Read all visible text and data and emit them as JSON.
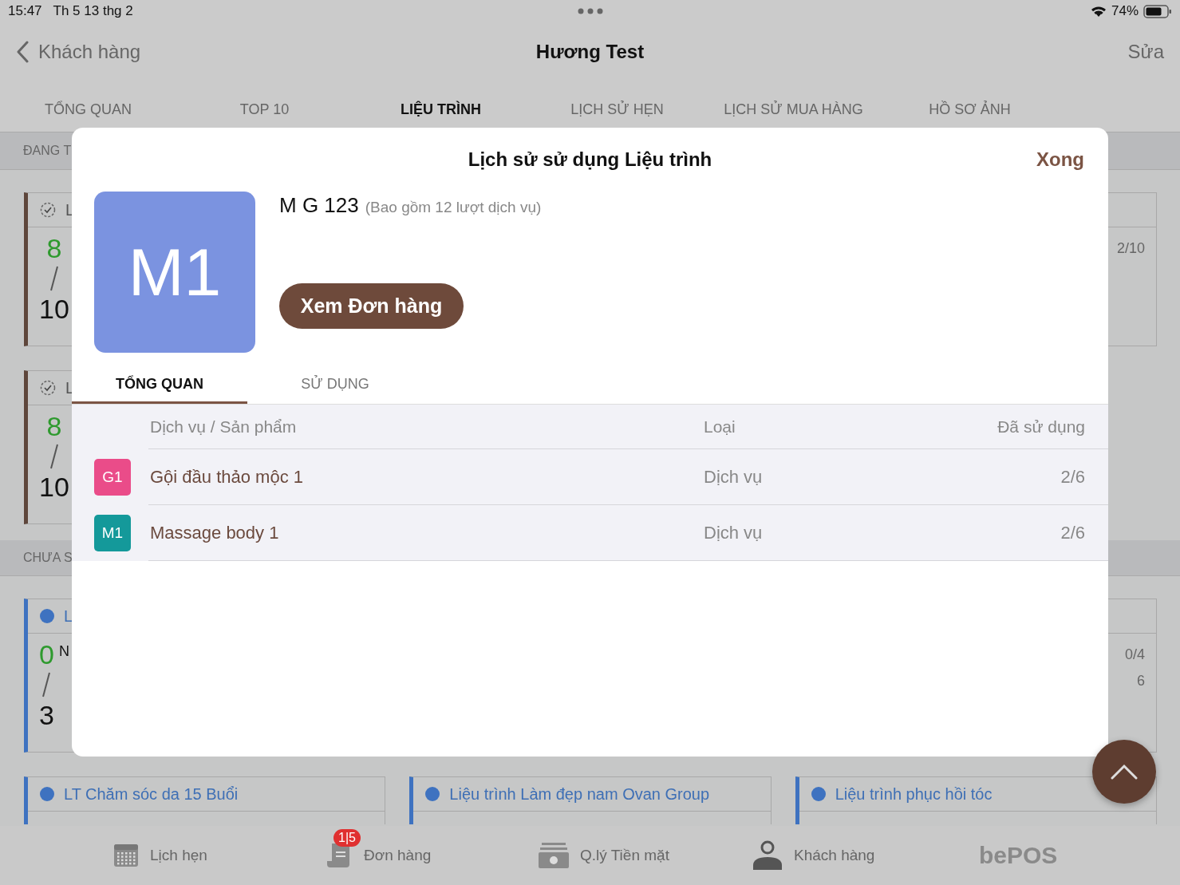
{
  "status_bar": {
    "time": "15:47",
    "date": "Th 5 13 thg 2",
    "battery": "74%"
  },
  "nav": {
    "back": "Khách hàng",
    "title": "Hương Test",
    "action": "Sửa"
  },
  "tabs": [
    {
      "label": "TỔNG QUAN",
      "selected": false
    },
    {
      "label": "TOP 10",
      "selected": false
    },
    {
      "label": "LIỆU TRÌNH",
      "selected": true
    },
    {
      "label": "LỊCH SỬ HẸN",
      "selected": false
    },
    {
      "label": "LỊCH SỬ MUA HÀNG",
      "selected": false
    },
    {
      "label": "HỒ SƠ ẢNH",
      "selected": false
    }
  ],
  "sections": [
    {
      "title": "ĐANG T",
      "rows": [
        [
          {
            "kind": "used",
            "title": "L",
            "used": "8",
            "total": "10"
          },
          null,
          {
            "kind": "used",
            "usage": "2/10"
          }
        ],
        [
          {
            "kind": "used",
            "title": "L",
            "used": "8",
            "total": "10"
          }
        ]
      ]
    },
    {
      "title": "CHƯA S",
      "rows": [
        [
          {
            "kind": "unused",
            "title": "L",
            "used": "0",
            "total": "3",
            "note": "N"
          },
          null,
          {
            "kind": "unused",
            "usage": "0/4",
            "extra": "6"
          }
        ],
        [
          {
            "kind": "unused",
            "title": "LT Chăm sóc da 15 Buổi"
          },
          {
            "kind": "unused",
            "title": "Liệu trình Làm đẹp nam Ovan Group"
          },
          {
            "kind": "unused",
            "title": "Liệu trình phục hồi tóc"
          }
        ]
      ]
    }
  ],
  "bottom_tabs": [
    {
      "kind": "calendar",
      "label": "Lịch hẹn"
    },
    {
      "kind": "orders",
      "label": "Đơn hàng",
      "badge": "1|5"
    },
    {
      "kind": "cash",
      "label": "Q.lý Tiền mặt"
    },
    {
      "kind": "person",
      "label": "Khách hàng"
    }
  ],
  "brand": "bePOS",
  "modal": {
    "title": "Lịch sử sử dụng Liệu trình",
    "done": "Xong",
    "avatar": "M1",
    "name": "M G 123",
    "subtitle": "(Bao gồm 12 lượt dịch vụ)",
    "button": "Xem Đơn hàng",
    "tabs": [
      {
        "label": "TỔNG QUAN",
        "selected": true
      },
      {
        "label": "SỬ DỤNG",
        "selected": false
      }
    ],
    "columns": [
      "Dịch vụ / Sản phẩm",
      "Loại",
      "Đã sử dụng"
    ],
    "rows": [
      {
        "badge": "G1",
        "color": "#ea4c89",
        "name": "Gội đầu thảo mộc 1",
        "type": "Dịch vụ",
        "used": "2/6"
      },
      {
        "badge": "M1",
        "color": "#14999a",
        "name": "Massage body 1",
        "type": "Dịch vụ",
        "used": "2/6"
      }
    ]
  }
}
